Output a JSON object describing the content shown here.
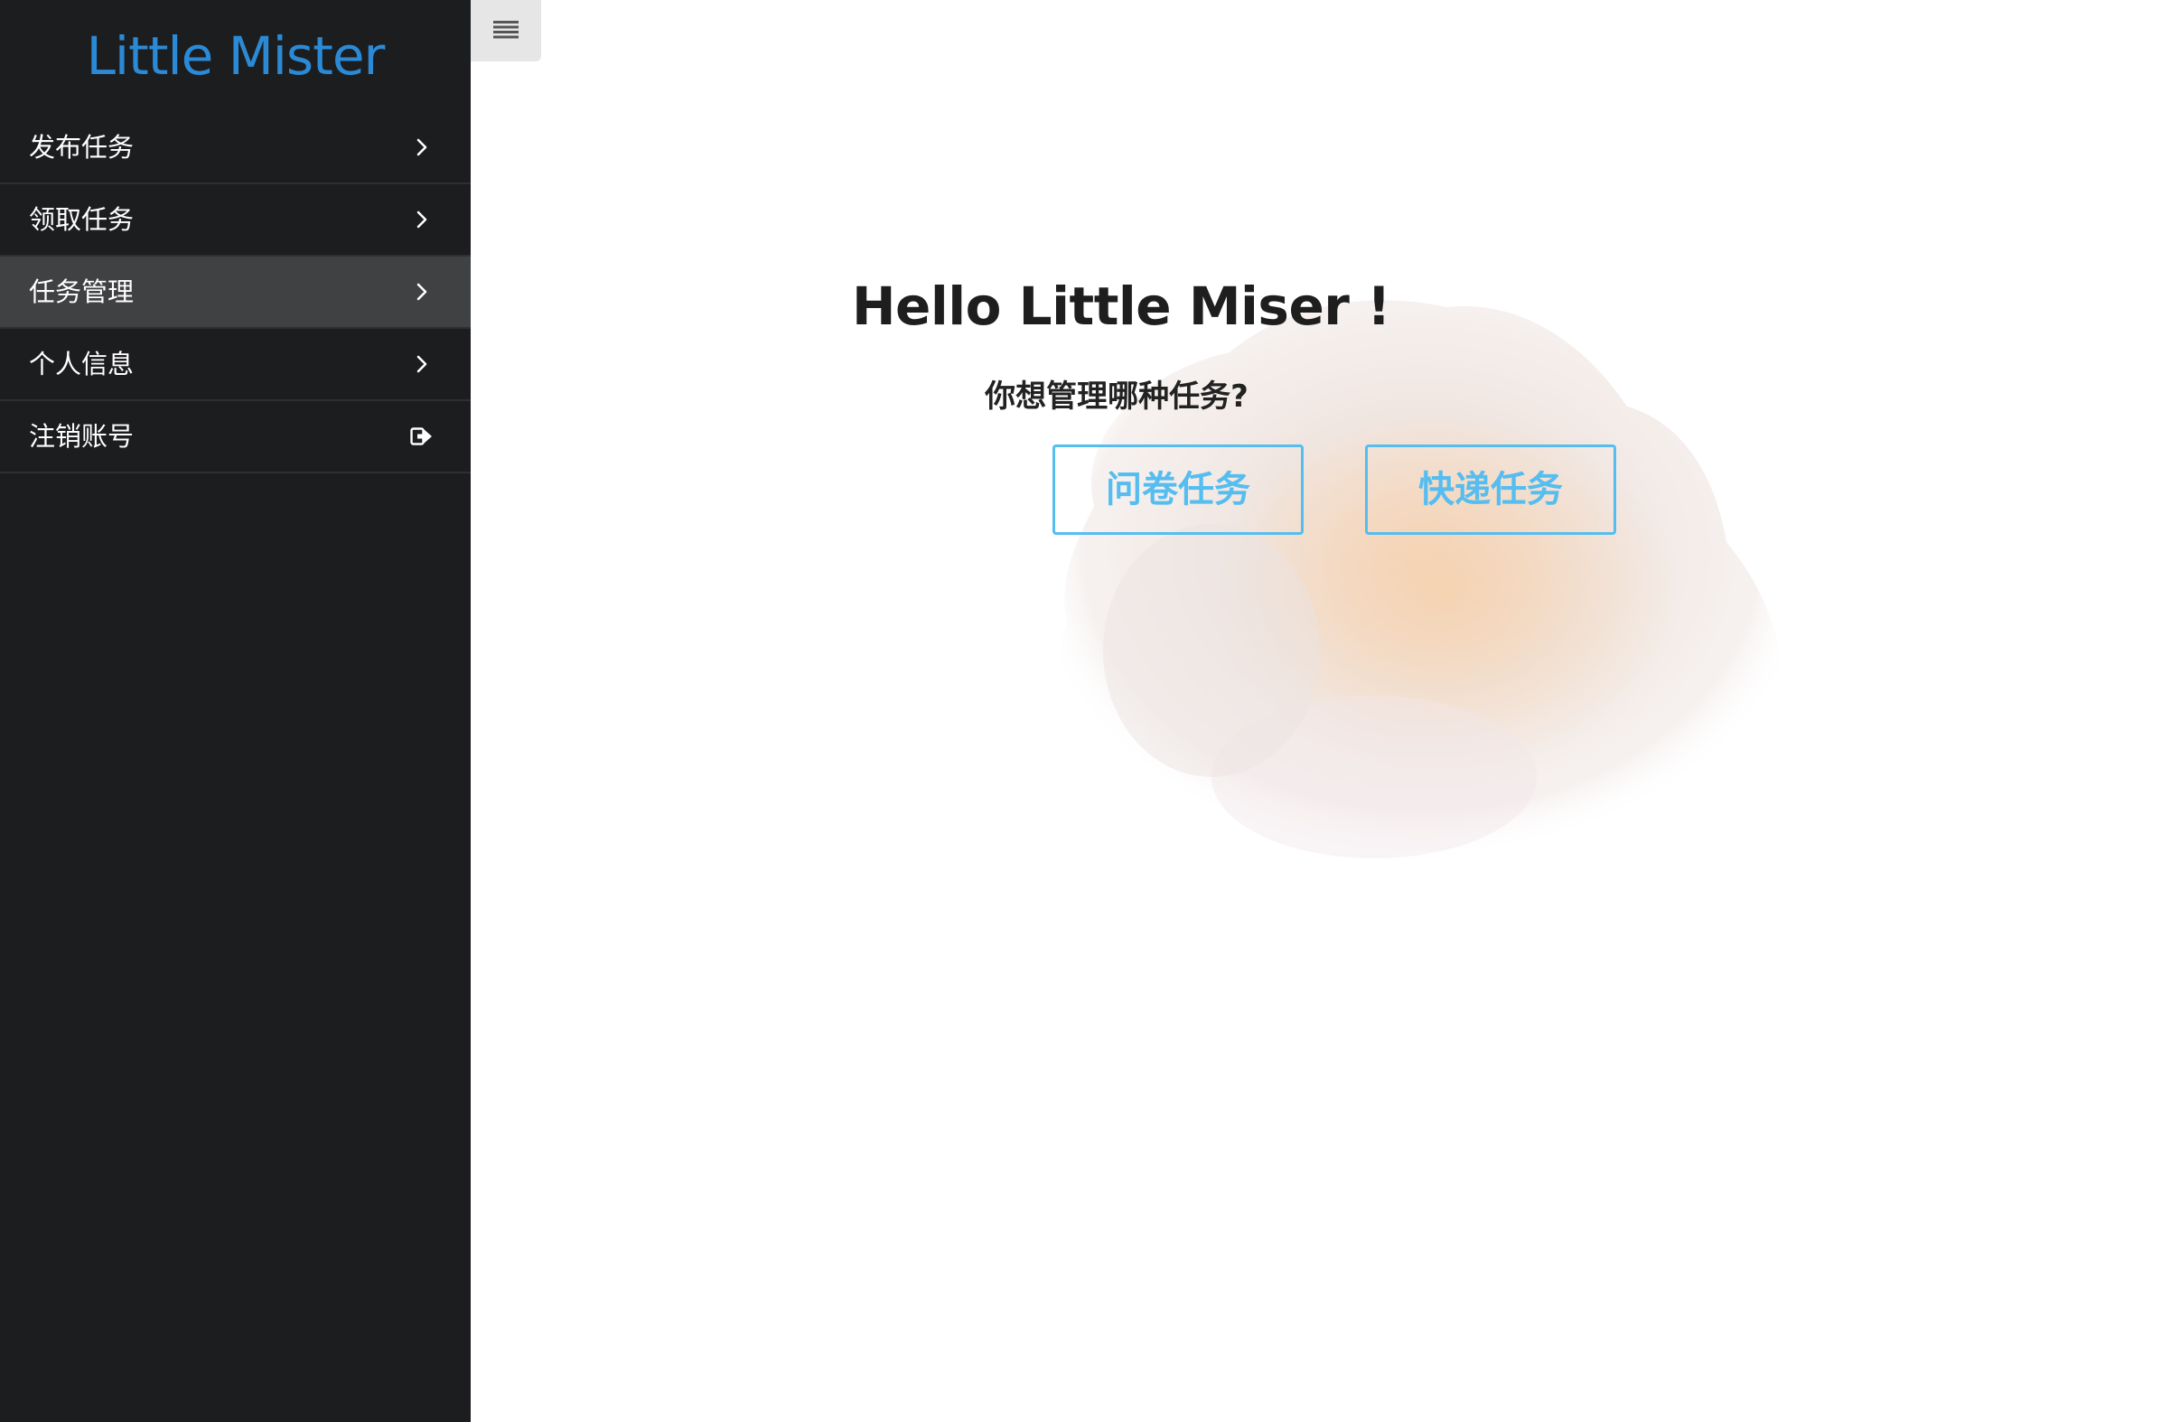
{
  "sidebar": {
    "brand": "Little Mister",
    "items": [
      {
        "label": "发布任务",
        "icon": "chevron-right-icon"
      },
      {
        "label": "领取任务",
        "icon": "chevron-right-icon"
      },
      {
        "label": "任务管理",
        "icon": "chevron-right-icon",
        "active": true
      },
      {
        "label": "个人信息",
        "icon": "chevron-right-icon"
      },
      {
        "label": "注销账号",
        "icon": "sign-out-icon"
      }
    ]
  },
  "toggle": {
    "icon": "hamburger-menu-icon"
  },
  "main": {
    "greeting": "Hello Little Miser !",
    "question": "你想管理哪种任务?",
    "buttons": {
      "survey": "问卷任务",
      "express": "快递任务"
    }
  },
  "colors": {
    "sidebar_bg": "#1c1d1f",
    "sidebar_active": "#404143",
    "brand": "#2b8ad6",
    "button_accent": "#55bdf0"
  }
}
